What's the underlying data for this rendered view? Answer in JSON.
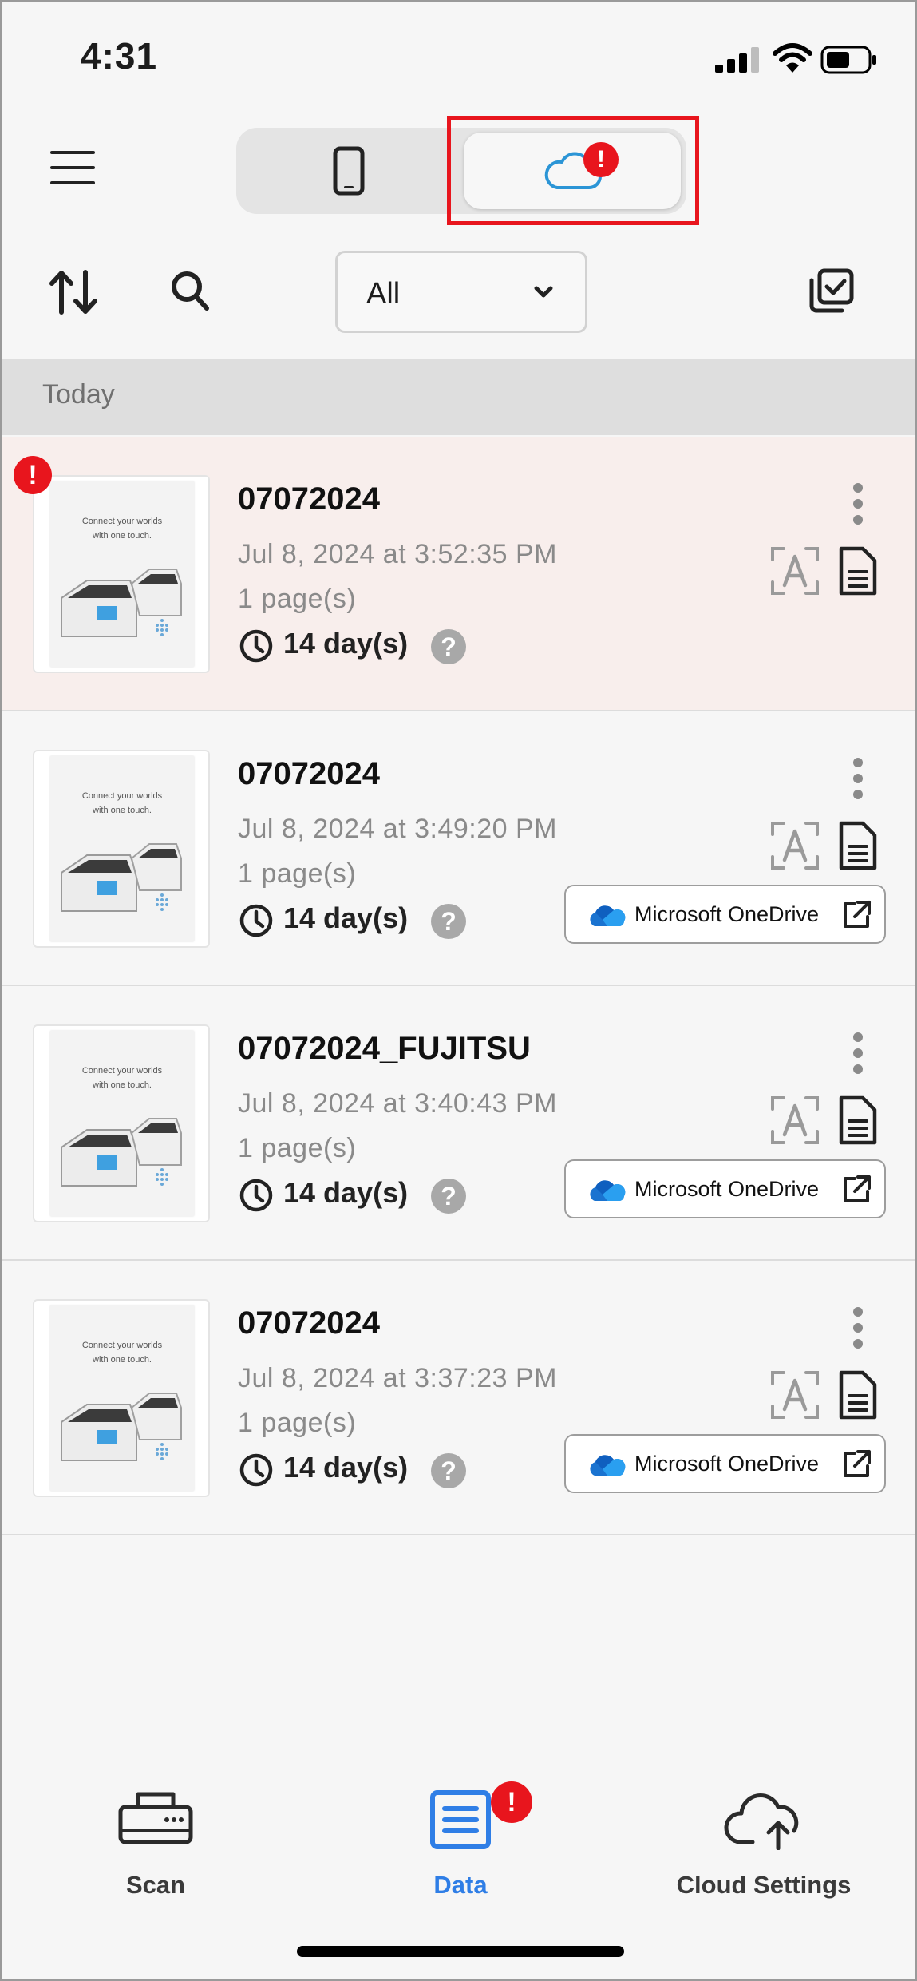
{
  "status_bar": {
    "time": "4:31"
  },
  "header": {
    "segments": [
      {
        "name": "device",
        "icon": "smartphone-icon",
        "selected": false
      },
      {
        "name": "cloud",
        "icon": "cloud-icon",
        "selected": true,
        "badge": "!"
      }
    ]
  },
  "toolbar": {
    "filter_value": "All"
  },
  "section": {
    "title": "Today"
  },
  "items": [
    {
      "title": "07072024",
      "date": "Jul 8, 2024 at 3:52:35 PM",
      "pages": "1 page(s)",
      "retention": "14 day(s)",
      "help": "?",
      "error_badge": "!",
      "destination": ""
    },
    {
      "title": "07072024",
      "date": "Jul 8, 2024 at 3:49:20 PM",
      "pages": "1 page(s)",
      "retention": "14 day(s)",
      "help": "?",
      "error_badge": "",
      "destination": "Microsoft OneDrive"
    },
    {
      "title": "07072024_FUJITSU",
      "date": "Jul 8, 2024 at 3:40:43 PM",
      "pages": "1 page(s)",
      "retention": "14 day(s)",
      "help": "?",
      "error_badge": "",
      "destination": "Microsoft OneDrive"
    },
    {
      "title": "07072024",
      "date": "Jul 8, 2024 at 3:37:23 PM",
      "pages": "1 page(s)",
      "retention": "14 day(s)",
      "help": "?",
      "error_badge": "",
      "destination": "Microsoft OneDrive"
    }
  ],
  "thumbnail_text": {
    "line1": "Connect your worlds",
    "line2": "with one touch."
  },
  "tab_bar": {
    "tabs": [
      {
        "label": "Scan",
        "icon": "scanner-icon",
        "active": false
      },
      {
        "label": "Data",
        "icon": "list-document-icon",
        "active": true,
        "badge": "!"
      },
      {
        "label": "Cloud Settings",
        "icon": "cloud-upload-icon",
        "active": false
      }
    ]
  },
  "colors": {
    "accent": "#2f7ee6",
    "alert": "#e8151d",
    "error_row": "#f8eeec",
    "cloud_icon": "#2b95d6"
  }
}
